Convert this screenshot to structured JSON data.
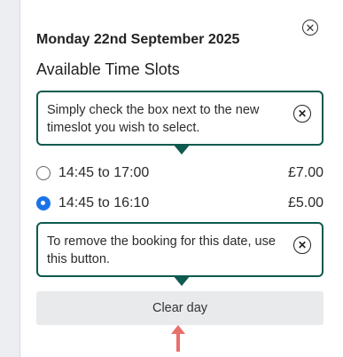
{
  "dialog": {
    "date_title": "Monday 22nd September 2025",
    "section_title": "Available Time Slots",
    "close_icon": "close-icon"
  },
  "tooltips": {
    "select_hint": "Simply check the box next to the new timeslot you wish to select.",
    "clear_hint": "To remove the booking for this date, use this button."
  },
  "slots": [
    {
      "time": "14:45 to 17:00",
      "price": "£7.00",
      "selected": false
    },
    {
      "time": "14:45 to 16:10",
      "price": "£5.00",
      "selected": true
    }
  ],
  "actions": {
    "clear_label": "Clear day"
  },
  "colors": {
    "accent_teal": "#0e5a4e",
    "radio_selected": "#1a73e8",
    "arrow": "#e8706d"
  }
}
